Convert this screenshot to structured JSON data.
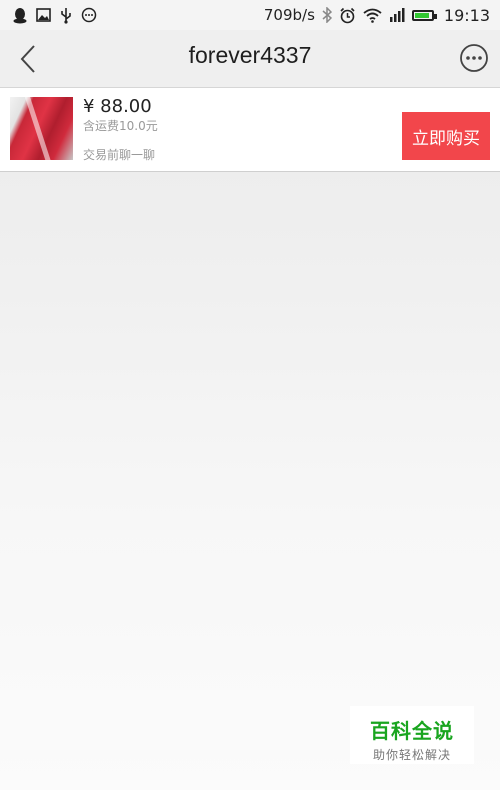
{
  "status_bar": {
    "speed": "709b/s",
    "time": "19:13",
    "icons": [
      "qq-icon",
      "image-icon",
      "usb-icon",
      "chat-bubble-icon",
      "bluetooth-icon",
      "alarm-icon",
      "wifi-icon",
      "signal-icon",
      "battery-icon"
    ],
    "battery_level": 0.9,
    "battery_color": "#32c832"
  },
  "nav": {
    "title": "forever4337",
    "back_icon": "chevron-left-icon",
    "more_icon": "more-horizontal-icon"
  },
  "product": {
    "price": "¥ 88.00",
    "shipping": "含运费10.0元",
    "chat_hint": "交易前聊一聊",
    "buy_label": "立即购买",
    "buy_color": "#f2464b"
  },
  "watermark": {
    "title": "百科全说",
    "subtitle": "助你轻松解决",
    "title_color": "#19a51f"
  }
}
